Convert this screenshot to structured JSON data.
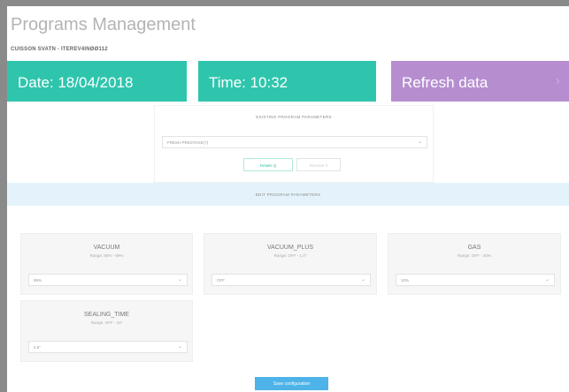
{
  "header": {
    "title": "Programs Management",
    "subtitle": "CUISSON SVATN - ITEREV4INØØ112"
  },
  "tiles": {
    "date": "Date: 18/04/2018",
    "time": "Time: 10:32",
    "refresh": "Refresh data",
    "refresh_icon": "refresh-arrow-icon"
  },
  "existing": {
    "title": "EXISTING PROGRAM PARAMETERS",
    "selected_program": "FRESH PRESTAGE(?)",
    "details_label": "Details Q",
    "remove_label": "Remove X"
  },
  "edit_bar": {
    "label": "EDIT PROGRAM PARAMETERS"
  },
  "params": [
    {
      "name": "VACUUM",
      "range": "Range: 80% - 99%",
      "value": "99%"
    },
    {
      "name": "VACUUM_PLUS",
      "range": "Range: OFF - 1.0\"",
      "value": "OFF"
    },
    {
      "name": "GAS",
      "range": "Range: OFF - 30%",
      "value": "10%"
    },
    {
      "name": "SEALING_TIME",
      "range": "Range: OFF - 10\"",
      "value": "4.5\""
    }
  ],
  "save_label": "Save configuration",
  "colors": {
    "accent_teal": "#2fc5ad",
    "accent_purple": "#b68ed0",
    "accent_blue": "#4db3e8",
    "edit_bar_bg": "#e4f3fb"
  }
}
